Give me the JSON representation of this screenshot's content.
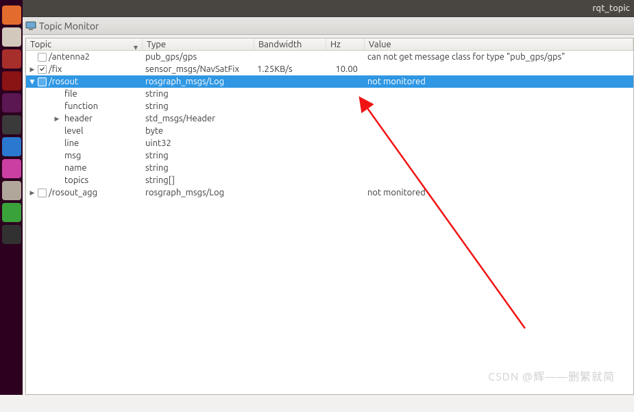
{
  "menubar": {
    "title": "rqt_topic"
  },
  "window": {
    "title": "Topic Monitor"
  },
  "columns": {
    "c0": "Topic",
    "c1": "Type",
    "c2": "Bandwidth",
    "c3": "Hz",
    "c4": "Value"
  },
  "rows": [
    {
      "indent": 0,
      "exp": "",
      "chk": "unchecked",
      "topic": "/antenna2",
      "type": "pub_gps/gps",
      "bw": "",
      "hz": "",
      "val": "can not get message class for type \"pub_gps/gps\""
    },
    {
      "indent": 0,
      "exp": "right",
      "chk": "checked",
      "topic": "/fix",
      "type": "sensor_msgs/NavSatFix",
      "bw": "1.25KB/s",
      "hz": "10.00",
      "val": ""
    },
    {
      "indent": 0,
      "exp": "down",
      "chk": "unchecked",
      "topic": "/rosout",
      "type": "rosgraph_msgs/Log",
      "bw": "",
      "hz": "",
      "val": "not monitored",
      "selected": true
    },
    {
      "indent": 1,
      "exp": "",
      "chk": "none",
      "topic": "file",
      "type": "string",
      "bw": "",
      "hz": "",
      "val": ""
    },
    {
      "indent": 1,
      "exp": "",
      "chk": "none",
      "topic": "function",
      "type": "string",
      "bw": "",
      "hz": "",
      "val": ""
    },
    {
      "indent": 1,
      "exp": "right",
      "chk": "none",
      "topic": "header",
      "type": "std_msgs/Header",
      "bw": "",
      "hz": "",
      "val": ""
    },
    {
      "indent": 1,
      "exp": "",
      "chk": "none",
      "topic": "level",
      "type": "byte",
      "bw": "",
      "hz": "",
      "val": ""
    },
    {
      "indent": 1,
      "exp": "",
      "chk": "none",
      "topic": "line",
      "type": "uint32",
      "bw": "",
      "hz": "",
      "val": ""
    },
    {
      "indent": 1,
      "exp": "",
      "chk": "none",
      "topic": "msg",
      "type": "string",
      "bw": "",
      "hz": "",
      "val": ""
    },
    {
      "indent": 1,
      "exp": "",
      "chk": "none",
      "topic": "name",
      "type": "string",
      "bw": "",
      "hz": "",
      "val": ""
    },
    {
      "indent": 1,
      "exp": "",
      "chk": "none",
      "topic": "topics",
      "type": "string[]",
      "bw": "",
      "hz": "",
      "val": ""
    },
    {
      "indent": 0,
      "exp": "right",
      "chk": "unchecked",
      "topic": "/rosout_agg",
      "type": "rosgraph_msgs/Log",
      "bw": "",
      "hz": "",
      "val": "not monitored"
    }
  ],
  "launcher_colors": [
    "#e46b2e",
    "#d3c8bc",
    "#a62f2c",
    "#8a1313",
    "#5a1752",
    "#3a3a3a",
    "#2a78cf",
    "#ca3fa1",
    "#b0a79a",
    "#3aa23a",
    "#313131"
  ],
  "watermark": "CSDN @辉——删繁就简"
}
